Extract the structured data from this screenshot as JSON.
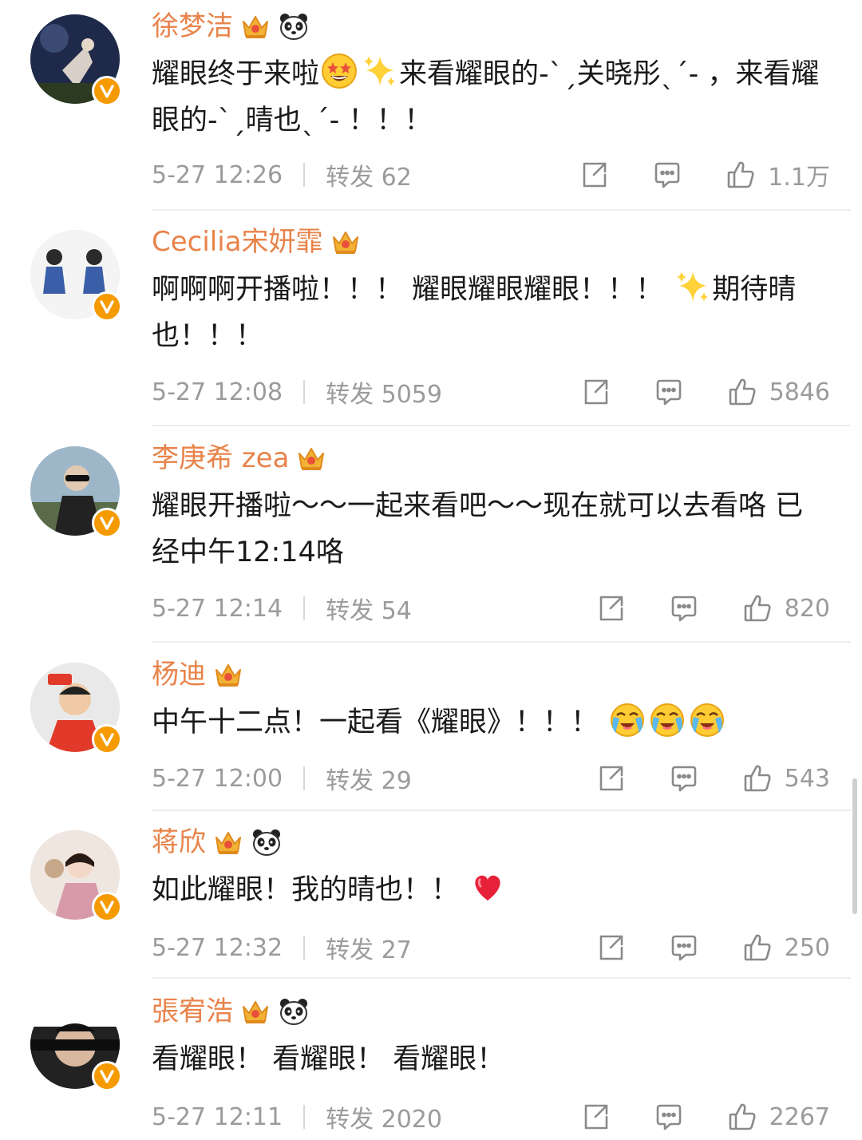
{
  "colors": {
    "name": "#e8834a",
    "meta": "#9b9b9b",
    "text": "#1a1a1a",
    "verified": "#f59a00"
  },
  "comments": [
    {
      "name": "徐梦洁",
      "badges": [
        "crown-icon",
        "panda-icon"
      ],
      "segments": [
        {
          "t": "耀眼终于来啦"
        },
        {
          "emoji": "star-struck-emoji"
        },
        {
          "emoji": "sparkles-emoji"
        },
        {
          "t": "来看耀眼的-ˋˏ关晓彤ˎˊ- ，来看耀眼的-ˋˏ晴也ˎˊ- ！！！"
        }
      ],
      "time": "5-27 12:26",
      "repost": "转发 62",
      "likes": "1.1万"
    },
    {
      "name": "Cecilia宋妍霏",
      "badges": [
        "crown-icon"
      ],
      "segments": [
        {
          "t": "啊啊啊开播啦！！！ 耀眼耀眼耀眼！！！ "
        },
        {
          "emoji": "sparkles-emoji"
        },
        {
          "t": "期待晴也！！！"
        }
      ],
      "time": "5-27 12:08",
      "repost": "转发 5059",
      "likes": "5846"
    },
    {
      "name": "李庚希 zea",
      "badges": [
        "crown-icon"
      ],
      "segments": [
        {
          "t": "耀眼开播啦～～一起来看吧～～现在就可以去看咯 已经中午12:14咯"
        }
      ],
      "time": "5-27 12:14",
      "repost": "转发 54",
      "likes": "820"
    },
    {
      "name": "杨迪",
      "badges": [
        "crown-icon"
      ],
      "segments": [
        {
          "t": "中午十二点！一起看《耀眼》！！！ "
        },
        {
          "emoji": "crying-face-emoji"
        },
        {
          "emoji": "crying-face-emoji"
        },
        {
          "emoji": "crying-face-emoji"
        }
      ],
      "time": "5-27 12:00",
      "repost": "转发 29",
      "likes": "543"
    },
    {
      "name": "蒋欣",
      "badges": [
        "crown-icon",
        "panda-icon"
      ],
      "segments": [
        {
          "t": "如此耀眼！我的晴也！！ "
        },
        {
          "emoji": "red-heart-emoji"
        }
      ],
      "time": "5-27 12:32",
      "repost": "转发 27",
      "likes": "250"
    },
    {
      "name": "張宥浩",
      "badges": [
        "crown-icon",
        "panda-icon"
      ],
      "segments": [
        {
          "t": "看耀眼！ 看耀眼！ 看耀眼！"
        }
      ],
      "time": "5-27 12:11",
      "repost": "转发 2020",
      "likes": "2267"
    }
  ]
}
